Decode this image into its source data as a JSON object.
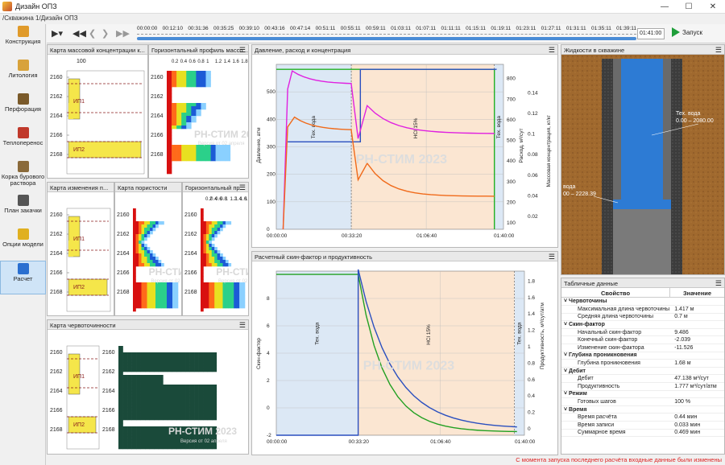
{
  "window": {
    "title": "Дизайн ОПЗ",
    "breadcrumb": "/Скважина 1/Дизайн ОПЗ"
  },
  "sidebar": {
    "items": [
      {
        "label": "Конструкция",
        "icon": "construction-icon",
        "color": "#e09a2a"
      },
      {
        "label": "Литология",
        "icon": "lithology-icon",
        "color": "#d8a23a"
      },
      {
        "label": "Перфорация",
        "icon": "perforation-icon",
        "color": "#7a5a2a"
      },
      {
        "label": "Теплоперенос",
        "icon": "thermometer-icon",
        "color": "#c0392b"
      },
      {
        "label": "Корка бурового раствора",
        "icon": "mudcake-icon",
        "color": "#8a6a3a"
      },
      {
        "label": "План закачки",
        "icon": "clock-icon",
        "color": "#555555"
      },
      {
        "label": "Опции модели",
        "icon": "options-icon",
        "color": "#e0b020"
      },
      {
        "label": "Расчет",
        "icon": "calc-icon",
        "color": "#2a6fd0"
      }
    ]
  },
  "toolbar": {
    "timeline": [
      "00:00:00",
      "00:12:10",
      "00:31:36",
      "00:35:25",
      "00:39:10",
      "00:43:16",
      "00:47:14",
      "00:51:11",
      "00:55:11",
      "00:59:11",
      "01:03:11",
      "01:07:11",
      "01:11:11",
      "01:15:11",
      "01:19:11",
      "01:23:11",
      "01:27:11",
      "01:31:11",
      "01:35:11",
      "01:39:11"
    ],
    "time_value": "01:41:00",
    "run_label": "Запуск"
  },
  "watermark": {
    "main": "РН-СТИМ 2023",
    "sub": "Версия от 02 апреля"
  },
  "panels": {
    "conc_map": "Карта массовой концентрации к...",
    "horiz_profile": "Горизонтальный профиль массо...",
    "perm_map": "Карта изменения п...",
    "porosity_map": "Карта пористости",
    "horiz_profile2": "Горизонтальный пр...",
    "wormhole_map": "Карта червоточинности",
    "pressure_chart": "Давление, расход и концентрация",
    "skin_chart": "Расчетный скин-фактор и продуктивность",
    "fluids": "Жидкости в скважине",
    "table": "Табличные данные"
  },
  "depth_ticks": [
    "2160",
    "2162",
    "2164",
    "2166",
    "2168"
  ],
  "strip": {
    "top_tick": "100",
    "layers": [
      "ИП1",
      "ИП2"
    ]
  },
  "profile_ticks": [
    "0.2",
    "0.4",
    "0.6",
    "0.8",
    "1",
    "1.2",
    "1.4",
    "1.6",
    "1.8"
  ],
  "fluids_panel": {
    "label1": "Тех. вода",
    "range1": "0.00 – 2080.00",
    "label2": "вода",
    "range2": "00 – 2228.39"
  },
  "pressure_chart": {
    "y1label": "Давление, атм",
    "y2label": "Расход, м³/сут",
    "y3label": "Массовая концентрация, кг/кг",
    "y1ticks": [
      "0",
      "100",
      "200",
      "300",
      "400",
      "500"
    ],
    "y2ticks": [
      "100",
      "200",
      "300",
      "400",
      "500",
      "600",
      "700",
      "800"
    ],
    "y3ticks": [
      "0.02",
      "0.04",
      "0.06",
      "0.08",
      "0.1",
      "0.12",
      "0.14"
    ],
    "xticks": [
      "00:00:00",
      "00:33:20",
      "01:06:40",
      "01:40:00"
    ],
    "stage_labels": [
      "Тех. вода",
      "НСl 15%",
      "Тех. вода"
    ]
  },
  "skin_chart": {
    "y1label": "Скин-фактор",
    "y2label": "Продуктивность, м³/сут/атм",
    "y1ticks": [
      "-2",
      "0",
      "2",
      "4",
      "6",
      "8"
    ],
    "y2ticks": [
      "0",
      "0.2",
      "0.4",
      "0.6",
      "0.8",
      "1",
      "1.2",
      "1.4",
      "1.6",
      "1.8"
    ],
    "xticks": [
      "00:00:00",
      "00:33:20",
      "01:06:40",
      "01:40:00"
    ],
    "stage_labels": [
      "Тех. вода",
      "НСl 15%",
      "Тех. вода"
    ]
  },
  "table": {
    "headers": [
      "Свойство",
      "Значение"
    ],
    "rows": [
      {
        "group": true,
        "name": "Червоточины",
        "value": ""
      },
      {
        "name": "Максимальная длина червоточины",
        "value": "1.417 м"
      },
      {
        "name": "Средняя длина червоточины",
        "value": "0.7 м"
      },
      {
        "group": true,
        "name": "Скин-фактор",
        "value": ""
      },
      {
        "name": "Начальный скин-фактор",
        "value": "9.486"
      },
      {
        "name": "Конечный скин-фактор",
        "value": "-2.039"
      },
      {
        "name": "Изменение скин-фактора",
        "value": "-11.526"
      },
      {
        "group": true,
        "name": "Глубина проникновения",
        "value": ""
      },
      {
        "name": "Глубина проникновения",
        "value": "1.68 м"
      },
      {
        "group": true,
        "name": "Дебит",
        "value": ""
      },
      {
        "name": "Дебит",
        "value": "47.138 м³/сут"
      },
      {
        "name": "Продуктивность",
        "value": "1.777 м³/сут/атм"
      },
      {
        "group": true,
        "name": "Режим",
        "value": ""
      },
      {
        "name": "Готовых шагов",
        "value": "100 %"
      },
      {
        "group": true,
        "name": "Время",
        "value": ""
      },
      {
        "name": "Время расчёта",
        "value": "0.44 мин"
      },
      {
        "name": "Время записи",
        "value": "0.033 мин"
      },
      {
        "name": "Суммарное время",
        "value": "0.469 мин"
      }
    ]
  },
  "status": "С момента запуска последнего расчёта входные данные были изменены"
}
